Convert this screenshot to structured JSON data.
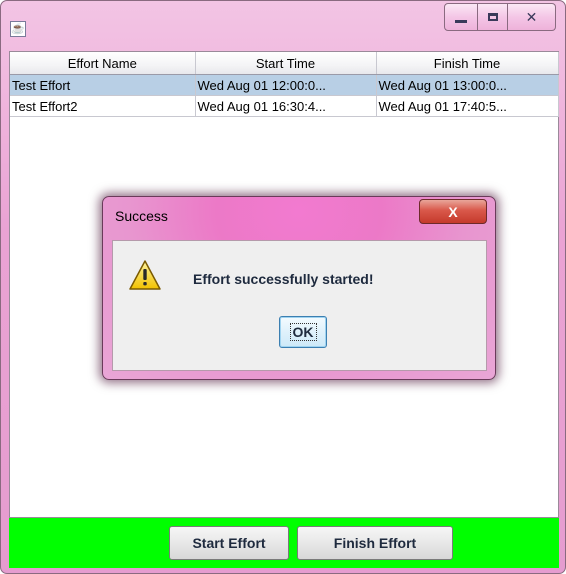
{
  "window": {
    "app_icon": "java-icon",
    "controls": {
      "minimize": "minimize-icon",
      "maximize": "maximize-icon",
      "close": "close-icon",
      "close_glyph": "✕"
    }
  },
  "table": {
    "columns": [
      "Effort Name",
      "Start Time",
      "Finish Time"
    ],
    "rows": [
      {
        "name": "Test Effort",
        "start": "Wed Aug 01 12:00:0...",
        "finish": "Wed Aug 01 13:00:0...",
        "selected": true
      },
      {
        "name": "Test Effort2",
        "start": "Wed Aug 01 16:30:4...",
        "finish": "Wed Aug 01 17:40:5...",
        "selected": false
      }
    ],
    "selection_color": "#b8cfe5"
  },
  "buttons": {
    "start_label": "Start Effort",
    "finish_label": "Finish Effort",
    "panel_color": "#00ff00"
  },
  "dialog": {
    "title": "Success",
    "message": "Effort successfully started!",
    "icon": "warning-icon",
    "ok_label": "OK",
    "close_glyph": "X"
  }
}
